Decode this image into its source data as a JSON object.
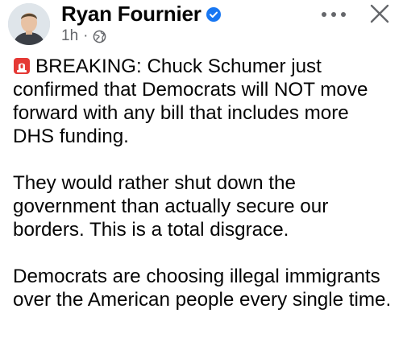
{
  "post": {
    "author": {
      "name": "Ryan Fournier",
      "verified": true,
      "avatar_icon": "profile-photo"
    },
    "meta": {
      "time": "1h",
      "separator": "·",
      "audience_icon": "globe-icon"
    },
    "actions": {
      "more_icon": "more-horizontal-icon",
      "close_icon": "close-icon"
    },
    "body": {
      "lead_icon": "police-siren-emoji",
      "paragraph_1": "BREAKING: Chuck Schumer just confirmed that Democrats will NOT move forward with any bill that includes more DHS funding.",
      "paragraph_2": "They would rather shut down the government than actually secure our borders. This is a total disgrace.",
      "paragraph_3": "Democrats are choosing illegal immigrants over the American people every single time."
    }
  },
  "colors": {
    "text": "#050505",
    "secondary": "#65676b",
    "verified": "#1877f2",
    "siren": "#e53935"
  }
}
